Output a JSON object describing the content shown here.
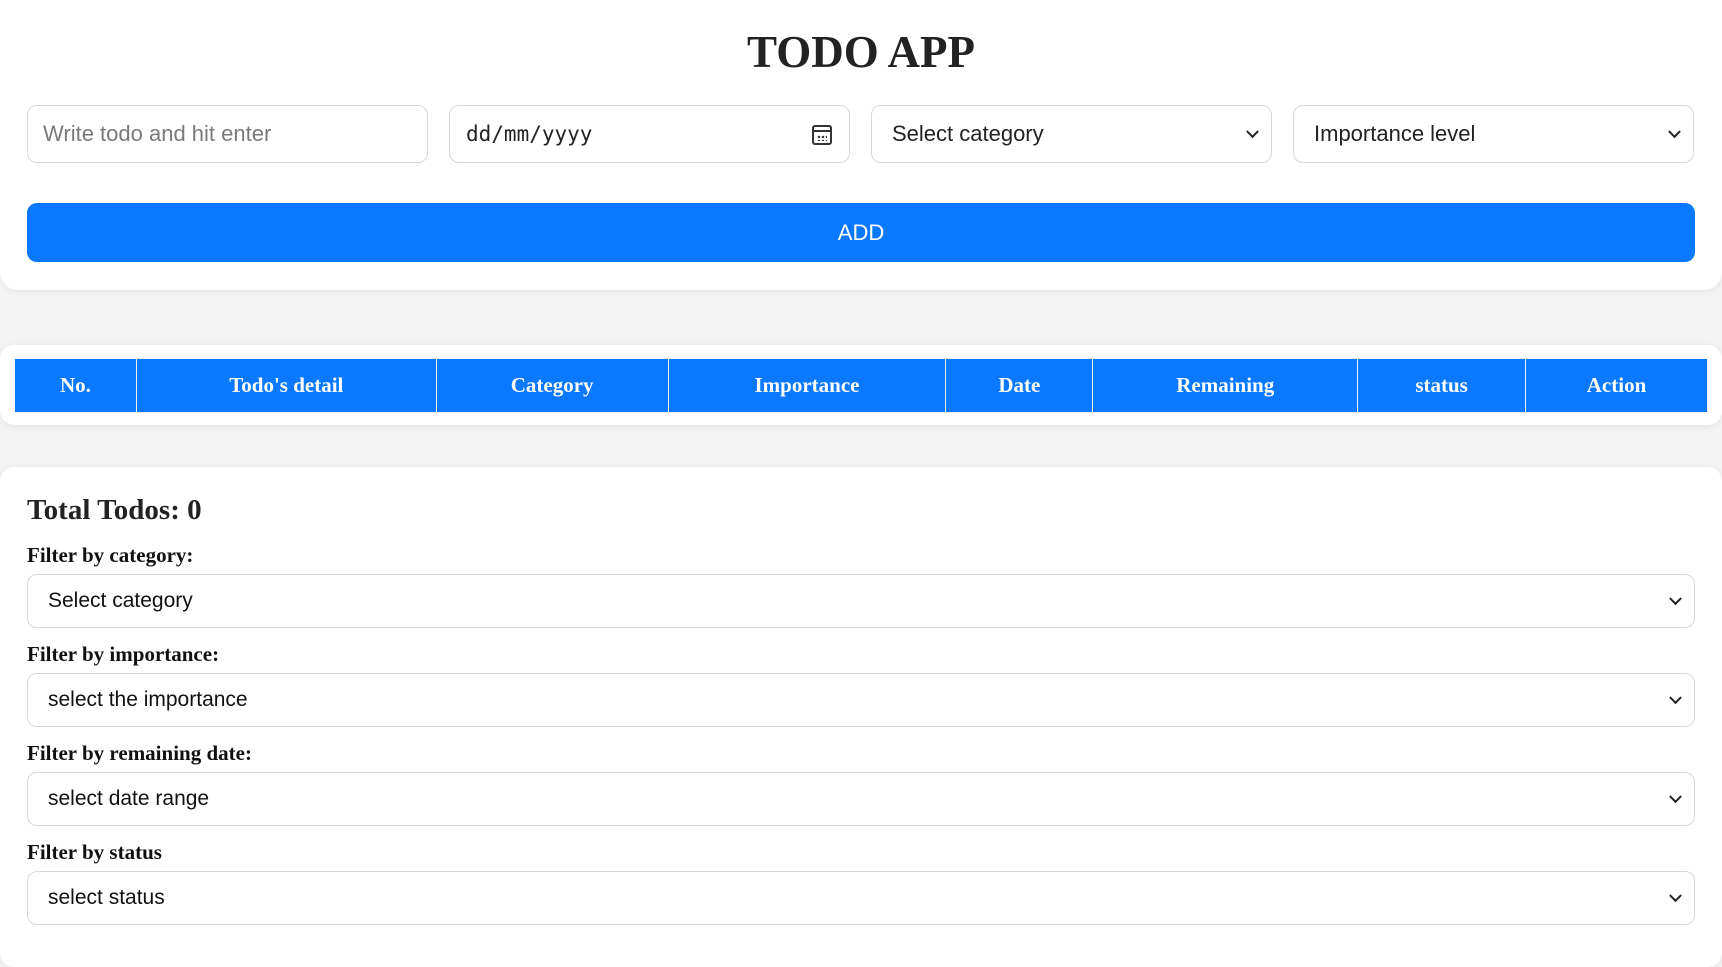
{
  "app": {
    "title": "TODO APP"
  },
  "form": {
    "todo_placeholder": "Write todo and hit enter",
    "date_placeholder": "dd/mm/yyyy",
    "category_selected": "Select category",
    "importance_selected": "Importance level",
    "add_label": "ADD"
  },
  "table": {
    "headers": [
      "No.",
      "Todo's detail",
      "Category",
      "Importance",
      "Date",
      "Remaining",
      "status",
      "Action"
    ]
  },
  "filters": {
    "total_label": "Total Todos: 0",
    "category": {
      "label": "Filter by category:",
      "selected": "Select category"
    },
    "importance": {
      "label": "Filter by importance:",
      "selected": "select the importance"
    },
    "remaining": {
      "label": "Filter by remaining date:",
      "selected": "select date range"
    },
    "status": {
      "label": "Filter by status",
      "selected": "select status"
    }
  },
  "colors": {
    "accent": "#0a78ff",
    "background": "#f4f4f4",
    "card": "#ffffff"
  },
  "icons": [
    "calendar-icon",
    "chevron-down-icon"
  ]
}
